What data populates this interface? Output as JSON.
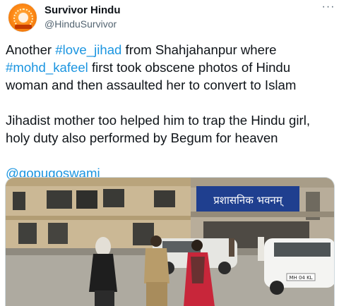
{
  "account": {
    "display_name": "Survivor Hindu",
    "handle": "@HinduSurvivor",
    "avatar_icon": "saffron-emblem-avatar"
  },
  "menu": {
    "icon": "more-options-icon",
    "glyph": "···"
  },
  "tweet": {
    "p1": {
      "t1": "Another ",
      "h1": "#love_jihad",
      "t2": " from Shahjahanpur where ",
      "h2": "#mohd_kafeel",
      "t3": " first took obscene photos of Hindu woman and then assaulted her to convert to Islam"
    },
    "p2": "Jihadist mother too helped him to trap the Hindu girl, holy duty also performed by Begum for heaven",
    "p3": {
      "mention": "@gopugoswami"
    }
  },
  "media": {
    "signboard_text": "प्रशासनिक भवनम्",
    "plate_text": "MH 04 KL"
  },
  "colors": {
    "link": "#1b95e0",
    "text": "#0f1419",
    "secondary": "#536471",
    "sign_blue": "#1f3f8f"
  }
}
